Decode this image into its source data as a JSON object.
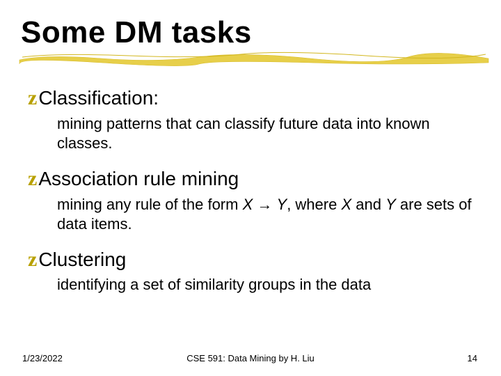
{
  "title": "Some DM tasks",
  "items": [
    {
      "heading": "Classification:",
      "desc_plain": "mining patterns that can classify future data into known classes."
    },
    {
      "heading": "Association rule mining",
      "desc_pre": "mining any rule of the form ",
      "x1": "X",
      "arrow": " → ",
      "y": "Y",
      "comma": ", where ",
      "x2": "X",
      "and": " and ",
      "y2": "Y",
      "post": " are sets of data items."
    },
    {
      "heading": "Clustering",
      "desc_plain": "identifying a set of similarity groups in the data"
    }
  ],
  "footer": {
    "date": "1/23/2022",
    "center": "CSE 591: Data Mining by H. Liu",
    "page": "14"
  },
  "bullet_glyph": "z"
}
